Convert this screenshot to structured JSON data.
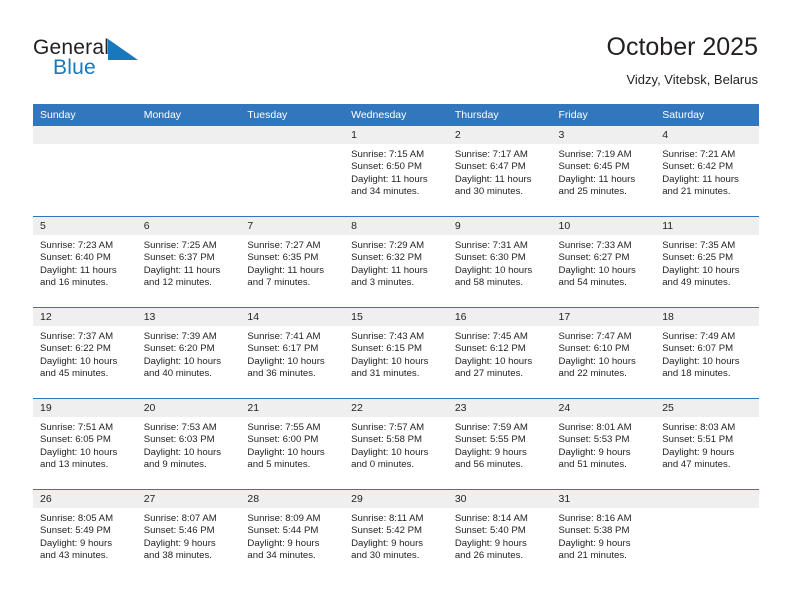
{
  "brand": {
    "name_part1": "General",
    "name_part2": "Blue",
    "mark_icon": "triangle-mark-icon",
    "accent_color": "#1878be"
  },
  "header": {
    "title": "October 2025",
    "subtitle": "Vidzy, Vitebsk, Belarus"
  },
  "colors": {
    "header_row": "#3277bd",
    "daynum_band": "#efefef",
    "text": "#231f20",
    "grid_line": "#3277bd"
  },
  "weekday_headers": [
    "Sunday",
    "Monday",
    "Tuesday",
    "Wednesday",
    "Thursday",
    "Friday",
    "Saturday"
  ],
  "weeks": [
    [
      {
        "day": "",
        "sunrise": "",
        "sunset": "",
        "daylight1": "",
        "daylight2": "",
        "empty": true
      },
      {
        "day": "",
        "sunrise": "",
        "sunset": "",
        "daylight1": "",
        "daylight2": "",
        "empty": true
      },
      {
        "day": "",
        "sunrise": "",
        "sunset": "",
        "daylight1": "",
        "daylight2": "",
        "empty": true
      },
      {
        "day": "1",
        "sunrise": "Sunrise: 7:15 AM",
        "sunset": "Sunset: 6:50 PM",
        "daylight1": "Daylight: 11 hours",
        "daylight2": "and 34 minutes."
      },
      {
        "day": "2",
        "sunrise": "Sunrise: 7:17 AM",
        "sunset": "Sunset: 6:47 PM",
        "daylight1": "Daylight: 11 hours",
        "daylight2": "and 30 minutes."
      },
      {
        "day": "3",
        "sunrise": "Sunrise: 7:19 AM",
        "sunset": "Sunset: 6:45 PM",
        "daylight1": "Daylight: 11 hours",
        "daylight2": "and 25 minutes."
      },
      {
        "day": "4",
        "sunrise": "Sunrise: 7:21 AM",
        "sunset": "Sunset: 6:42 PM",
        "daylight1": "Daylight: 11 hours",
        "daylight2": "and 21 minutes."
      }
    ],
    [
      {
        "day": "5",
        "sunrise": "Sunrise: 7:23 AM",
        "sunset": "Sunset: 6:40 PM",
        "daylight1": "Daylight: 11 hours",
        "daylight2": "and 16 minutes."
      },
      {
        "day": "6",
        "sunrise": "Sunrise: 7:25 AM",
        "sunset": "Sunset: 6:37 PM",
        "daylight1": "Daylight: 11 hours",
        "daylight2": "and 12 minutes."
      },
      {
        "day": "7",
        "sunrise": "Sunrise: 7:27 AM",
        "sunset": "Sunset: 6:35 PM",
        "daylight1": "Daylight: 11 hours",
        "daylight2": "and 7 minutes."
      },
      {
        "day": "8",
        "sunrise": "Sunrise: 7:29 AM",
        "sunset": "Sunset: 6:32 PM",
        "daylight1": "Daylight: 11 hours",
        "daylight2": "and 3 minutes."
      },
      {
        "day": "9",
        "sunrise": "Sunrise: 7:31 AM",
        "sunset": "Sunset: 6:30 PM",
        "daylight1": "Daylight: 10 hours",
        "daylight2": "and 58 minutes."
      },
      {
        "day": "10",
        "sunrise": "Sunrise: 7:33 AM",
        "sunset": "Sunset: 6:27 PM",
        "daylight1": "Daylight: 10 hours",
        "daylight2": "and 54 minutes."
      },
      {
        "day": "11",
        "sunrise": "Sunrise: 7:35 AM",
        "sunset": "Sunset: 6:25 PM",
        "daylight1": "Daylight: 10 hours",
        "daylight2": "and 49 minutes."
      }
    ],
    [
      {
        "day": "12",
        "sunrise": "Sunrise: 7:37 AM",
        "sunset": "Sunset: 6:22 PM",
        "daylight1": "Daylight: 10 hours",
        "daylight2": "and 45 minutes."
      },
      {
        "day": "13",
        "sunrise": "Sunrise: 7:39 AM",
        "sunset": "Sunset: 6:20 PM",
        "daylight1": "Daylight: 10 hours",
        "daylight2": "and 40 minutes."
      },
      {
        "day": "14",
        "sunrise": "Sunrise: 7:41 AM",
        "sunset": "Sunset: 6:17 PM",
        "daylight1": "Daylight: 10 hours",
        "daylight2": "and 36 minutes."
      },
      {
        "day": "15",
        "sunrise": "Sunrise: 7:43 AM",
        "sunset": "Sunset: 6:15 PM",
        "daylight1": "Daylight: 10 hours",
        "daylight2": "and 31 minutes."
      },
      {
        "day": "16",
        "sunrise": "Sunrise: 7:45 AM",
        "sunset": "Sunset: 6:12 PM",
        "daylight1": "Daylight: 10 hours",
        "daylight2": "and 27 minutes."
      },
      {
        "day": "17",
        "sunrise": "Sunrise: 7:47 AM",
        "sunset": "Sunset: 6:10 PM",
        "daylight1": "Daylight: 10 hours",
        "daylight2": "and 22 minutes."
      },
      {
        "day": "18",
        "sunrise": "Sunrise: 7:49 AM",
        "sunset": "Sunset: 6:07 PM",
        "daylight1": "Daylight: 10 hours",
        "daylight2": "and 18 minutes."
      }
    ],
    [
      {
        "day": "19",
        "sunrise": "Sunrise: 7:51 AM",
        "sunset": "Sunset: 6:05 PM",
        "daylight1": "Daylight: 10 hours",
        "daylight2": "and 13 minutes."
      },
      {
        "day": "20",
        "sunrise": "Sunrise: 7:53 AM",
        "sunset": "Sunset: 6:03 PM",
        "daylight1": "Daylight: 10 hours",
        "daylight2": "and 9 minutes."
      },
      {
        "day": "21",
        "sunrise": "Sunrise: 7:55 AM",
        "sunset": "Sunset: 6:00 PM",
        "daylight1": "Daylight: 10 hours",
        "daylight2": "and 5 minutes."
      },
      {
        "day": "22",
        "sunrise": "Sunrise: 7:57 AM",
        "sunset": "Sunset: 5:58 PM",
        "daylight1": "Daylight: 10 hours",
        "daylight2": "and 0 minutes."
      },
      {
        "day": "23",
        "sunrise": "Sunrise: 7:59 AM",
        "sunset": "Sunset: 5:55 PM",
        "daylight1": "Daylight: 9 hours",
        "daylight2": "and 56 minutes."
      },
      {
        "day": "24",
        "sunrise": "Sunrise: 8:01 AM",
        "sunset": "Sunset: 5:53 PM",
        "daylight1": "Daylight: 9 hours",
        "daylight2": "and 51 minutes."
      },
      {
        "day": "25",
        "sunrise": "Sunrise: 8:03 AM",
        "sunset": "Sunset: 5:51 PM",
        "daylight1": "Daylight: 9 hours",
        "daylight2": "and 47 minutes."
      }
    ],
    [
      {
        "day": "26",
        "sunrise": "Sunrise: 8:05 AM",
        "sunset": "Sunset: 5:49 PM",
        "daylight1": "Daylight: 9 hours",
        "daylight2": "and 43 minutes."
      },
      {
        "day": "27",
        "sunrise": "Sunrise: 8:07 AM",
        "sunset": "Sunset: 5:46 PM",
        "daylight1": "Daylight: 9 hours",
        "daylight2": "and 38 minutes."
      },
      {
        "day": "28",
        "sunrise": "Sunrise: 8:09 AM",
        "sunset": "Sunset: 5:44 PM",
        "daylight1": "Daylight: 9 hours",
        "daylight2": "and 34 minutes."
      },
      {
        "day": "29",
        "sunrise": "Sunrise: 8:11 AM",
        "sunset": "Sunset: 5:42 PM",
        "daylight1": "Daylight: 9 hours",
        "daylight2": "and 30 minutes."
      },
      {
        "day": "30",
        "sunrise": "Sunrise: 8:14 AM",
        "sunset": "Sunset: 5:40 PM",
        "daylight1": "Daylight: 9 hours",
        "daylight2": "and 26 minutes."
      },
      {
        "day": "31",
        "sunrise": "Sunrise: 8:16 AM",
        "sunset": "Sunset: 5:38 PM",
        "daylight1": "Daylight: 9 hours",
        "daylight2": "and 21 minutes."
      },
      {
        "day": "",
        "sunrise": "",
        "sunset": "",
        "daylight1": "",
        "daylight2": "",
        "empty": true
      }
    ]
  ]
}
